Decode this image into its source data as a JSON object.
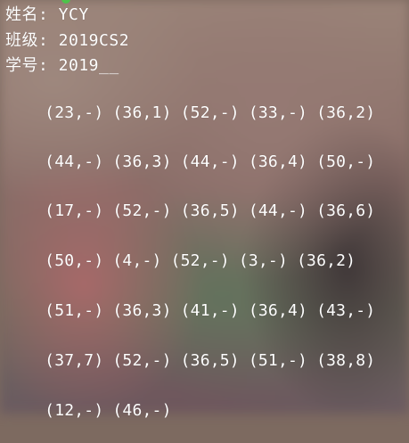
{
  "terminal": {
    "header": {
      "name_line": "姓名: YCY",
      "class_line": "班级: 2019CS2",
      "id_line": "学号: 2019__"
    },
    "rows": [
      [
        "(23,-)",
        "(36,1)",
        "(52,-)",
        "(33,-)",
        "(36,2)"
      ],
      [
        "(44,-)",
        "(36,3)",
        "(44,-)",
        "(36,4)",
        "(50,-)"
      ],
      [
        "(17,-)",
        "(52,-)",
        "(36,5)",
        "(44,-)",
        "(36,6)"
      ],
      [
        "(50,-)",
        "(4,-)",
        "(52,-)",
        "(3,-)",
        "(36,2)"
      ],
      [
        "(51,-)",
        "(36,3)",
        "(41,-)",
        "(36,4)",
        "(43,-)"
      ],
      [
        "(37,7)",
        "(52,-)",
        "(36,5)",
        "(51,-)",
        "(38,8)"
      ],
      [
        "(12,-)",
        "(46,-)"
      ]
    ],
    "colors": {
      "text": "#ffffff",
      "cursor_dot": "#4ec24b"
    }
  }
}
